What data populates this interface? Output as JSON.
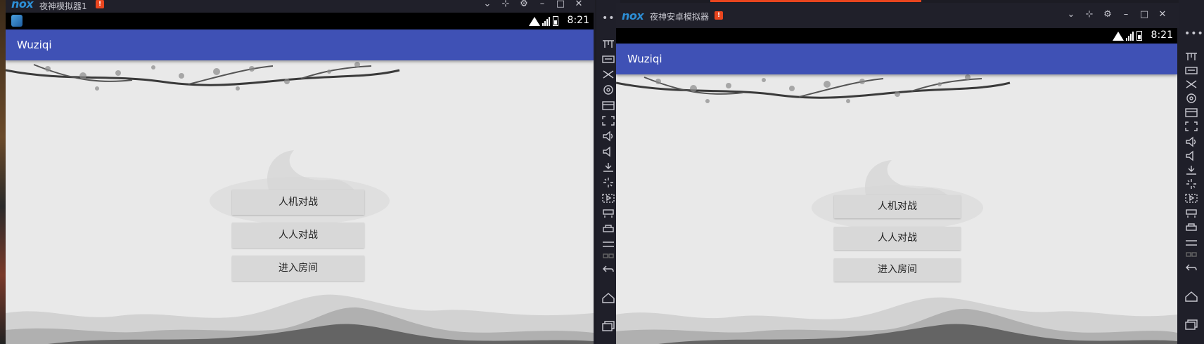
{
  "left_window": {
    "title": "夜神模拟器1",
    "status_time": "8:21",
    "app_title": "Wuziqi",
    "buttons": [
      "人机对战",
      "人人对战",
      "进入房间"
    ],
    "sidebar_more": "•••"
  },
  "right_window": {
    "title": "夜神安卓模拟器",
    "logo": "nox",
    "status_time": "8:21",
    "app_title": "Wuziqi",
    "buttons": [
      "人机对战",
      "人人对战",
      "进入房间"
    ],
    "sidebar_more": "•••"
  },
  "left_logo": "nox",
  "alert_badge": "!",
  "colors": {
    "appbar": "#3f51b5",
    "title_bar": "#20202a",
    "content_bg": "#e9e9e9",
    "button_bg": "#d8d8d8"
  },
  "sidebar_icons": [
    "toolbar-icon",
    "keyboard-icon",
    "shake-icon",
    "screenshot-icon",
    "layout-icon",
    "fullscreen-icon",
    "volume-up-icon",
    "volume-down-icon",
    "install-apk-icon",
    "loading-icon",
    "macro-icon",
    "multi-instance-icon",
    "printer-icon",
    "menu-icon",
    "split-icon",
    "back-icon",
    "home-icon",
    "recent-apps-icon"
  ]
}
